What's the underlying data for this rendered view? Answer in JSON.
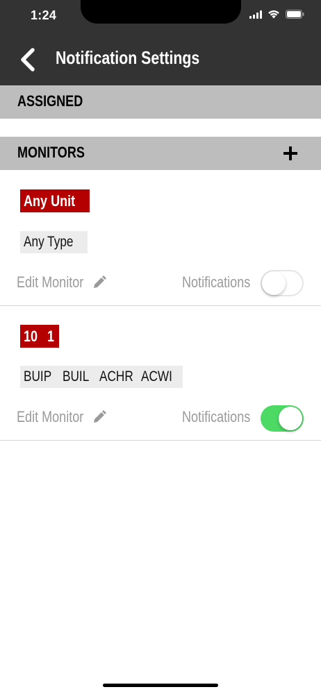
{
  "status_bar": {
    "time": "1:24"
  },
  "header": {
    "title": "Notification Settings"
  },
  "sections": {
    "assigned_label": "ASSIGNED",
    "monitors_label": "MONITORS"
  },
  "monitors": [
    {
      "units": [
        "Any Unit"
      ],
      "types": [
        "Any Type"
      ],
      "edit_label": "Edit Monitor",
      "notifications_label": "Notifications",
      "notifications_on": false
    },
    {
      "units": [
        "10",
        "1"
      ],
      "types": [
        "BUIP",
        "BUIL",
        "ACHR",
        "ACWI"
      ],
      "edit_label": "Edit Monitor",
      "notifications_label": "Notifications",
      "notifications_on": true
    }
  ],
  "icons": {
    "back": "chevron-left-icon",
    "add": "plus-icon",
    "edit": "pencil-icon",
    "signal": "signal-icon",
    "wifi": "wifi-icon",
    "battery": "battery-icon"
  },
  "colors": {
    "header_bg": "#333333",
    "section_bg": "#bdbdbd",
    "unit_chip": "#b40000",
    "type_chip": "#ececec",
    "toggle_on": "#4cd964",
    "muted_text": "#9a9a9a"
  }
}
